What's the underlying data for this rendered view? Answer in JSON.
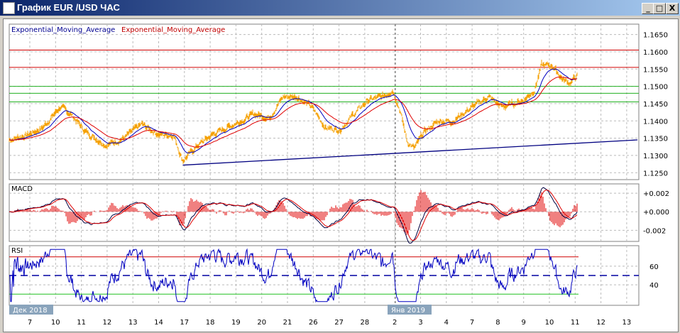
{
  "window": {
    "title": "График EUR /USD  ЧАС",
    "minimize": "_",
    "maximize": "□",
    "close": "X"
  },
  "legend": {
    "ema1": "Exponential_Moving_Average",
    "ema2": "Exponential_Moving_Average"
  },
  "panels": {
    "macd": "MACD",
    "rsi": "RSI"
  },
  "month_labels": [
    "Дек 2018",
    "Янв 2019"
  ],
  "colors": {
    "price": "#f5a000",
    "ema_fast": "#0000c0",
    "ema_slow": "#e00000",
    "resistance": "#d00000",
    "support": "#20b020",
    "trend": "#000080"
  },
  "chart_data": {
    "type": "line",
    "price_axis": {
      "ticks": [
        "1.1650",
        "1.1600",
        "1.1550",
        "1.1500",
        "1.1450",
        "1.1400",
        "1.1350",
        "1.1300",
        "1.1250"
      ],
      "range": [
        1.123,
        1.168
      ]
    },
    "macd_axis": {
      "ticks": [
        "+0.002",
        "+0.000",
        "-0.002"
      ],
      "range": [
        -0.0032,
        0.003
      ]
    },
    "rsi_axis": {
      "ticks": [
        "60",
        "40"
      ],
      "range": [
        18,
        82
      ],
      "overbought": 70,
      "oversold": 30,
      "mid": 50
    },
    "x_ticks": [
      "7",
      "10",
      "11",
      "12",
      "13",
      "14",
      "17",
      "18",
      "19",
      "20",
      "21",
      "26",
      "27",
      "28",
      "2",
      "3",
      "4",
      "7",
      "8",
      "9",
      "10",
      "11",
      "12",
      "13"
    ],
    "levels": {
      "red": [
        1.1605,
        1.1555
      ],
      "green": [
        1.15,
        1.148,
        1.1455
      ]
    },
    "trend_line": [
      [
        5.84,
        1.1272
      ],
      [
        23.2,
        1.1345
      ]
    ],
    "price": [
      [
        -0.78,
        1.1345
      ],
      [
        -0.05,
        1.136
      ],
      [
        0.49,
        1.138
      ],
      [
        1.16,
        1.144
      ],
      [
        1.57,
        1.142
      ],
      [
        2.11,
        1.137
      ],
      [
        2.92,
        1.133
      ],
      [
        3.59,
        1.135
      ],
      [
        4.27,
        1.139
      ],
      [
        4.95,
        1.136
      ],
      [
        5.49,
        1.136
      ],
      [
        5.84,
        1.1285
      ],
      [
        6.43,
        1.133
      ],
      [
        6.97,
        1.136
      ],
      [
        7.78,
        1.139
      ],
      [
        8.59,
        1.142
      ],
      [
        9.14,
        1.141
      ],
      [
        9.68,
        1.147
      ],
      [
        10.22,
        1.147
      ],
      [
        10.76,
        1.144
      ],
      [
        11.3,
        1.138
      ],
      [
        11.84,
        1.1375
      ],
      [
        12.38,
        1.142
      ],
      [
        12.92,
        1.146
      ],
      [
        13.46,
        1.147
      ],
      [
        13.86,
        1.149
      ],
      [
        14.14,
        1.143
      ],
      [
        14.41,
        1.134
      ],
      [
        14.68,
        1.132
      ],
      [
        15.08,
        1.137
      ],
      [
        15.62,
        1.14
      ],
      [
        16.16,
        1.14
      ],
      [
        16.7,
        1.143
      ],
      [
        17.51,
        1.147
      ],
      [
        18.05,
        1.144
      ],
      [
        18.86,
        1.146
      ],
      [
        19.27,
        1.149
      ],
      [
        19.54,
        1.156
      ],
      [
        19.95,
        1.156
      ],
      [
        20.35,
        1.152
      ],
      [
        20.62,
        1.151
      ],
      [
        20.89,
        1.153
      ]
    ]
  }
}
